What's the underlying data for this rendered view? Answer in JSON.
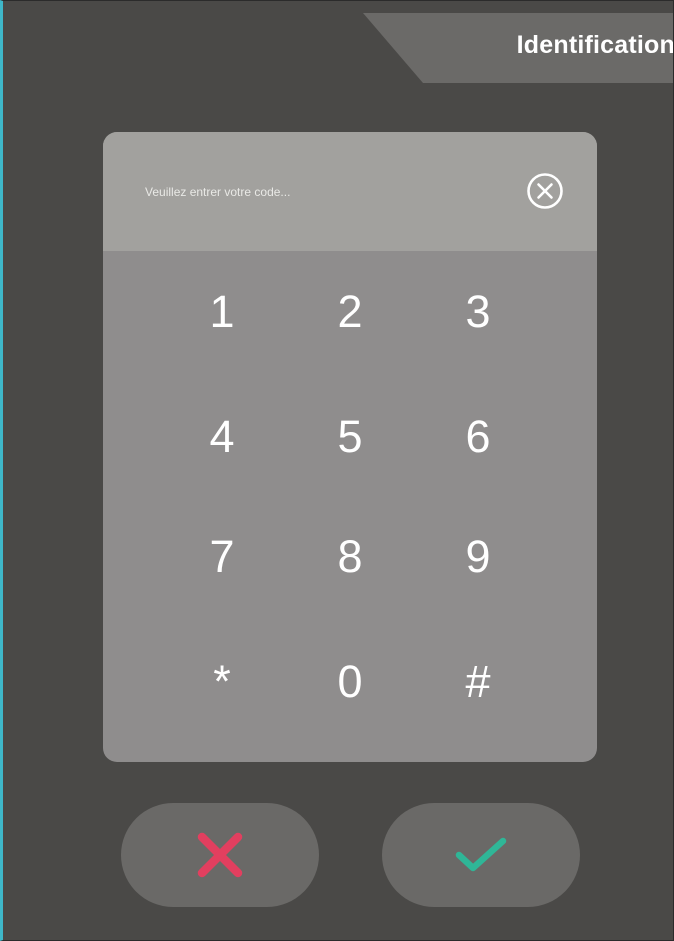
{
  "header": {
    "title": "Identification"
  },
  "code_entry": {
    "placeholder": "Veuillez entrer votre code...",
    "value": "",
    "clear_icon": "circle-x-icon"
  },
  "keypad": {
    "keys": [
      "1",
      "2",
      "3",
      "4",
      "5",
      "6",
      "7",
      "8",
      "9",
      "*",
      "0",
      "#"
    ]
  },
  "actions": {
    "cancel_icon": "cross-icon",
    "confirm_icon": "check-icon"
  },
  "colors": {
    "background": "#4a4947",
    "tab": "#6b6a68",
    "keypad": "#8f8d8d",
    "code_bar": "#a2a19e",
    "cancel": "#e23f5f",
    "confirm": "#2fb697",
    "frame_accent": "#3fb7c9"
  }
}
